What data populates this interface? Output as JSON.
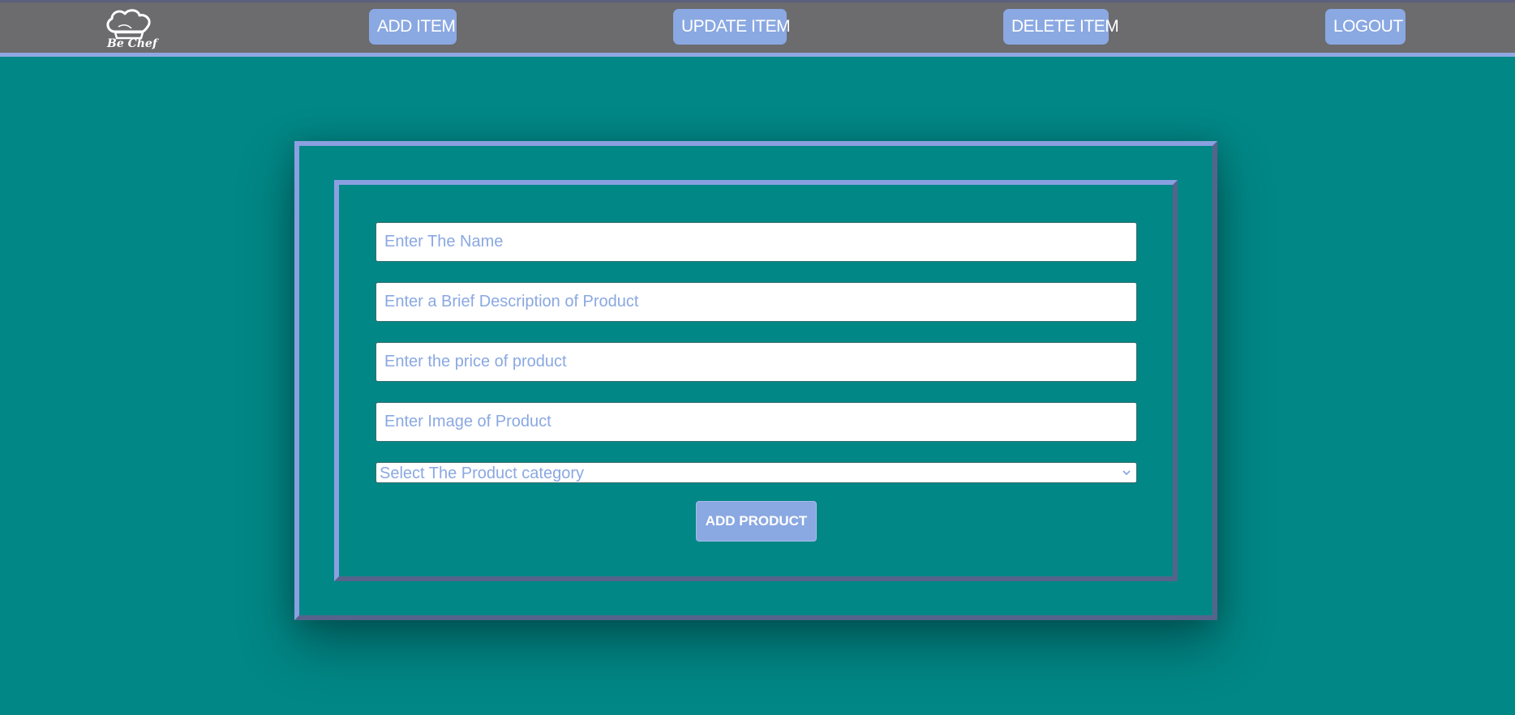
{
  "brand": {
    "logo_icon": "chef-hat-icon",
    "name": "Be Chef"
  },
  "nav": {
    "add_item": "ADD ITEM",
    "update_item": "UPDATE ITEM",
    "delete_item": "DELETE ITEM",
    "logout": "LOGOUT"
  },
  "form": {
    "name_placeholder": "Enter The Name",
    "description_placeholder": "Enter a Brief Description of Product",
    "price_placeholder": "Enter the price of product",
    "image_placeholder": "Enter Image of Product",
    "category_selected": "Select The Product category",
    "submit_label": "ADD PRODUCT"
  },
  "colors": {
    "background": "#018786",
    "navbar": "#6c6b6d",
    "accent": "#8aa8e2"
  }
}
